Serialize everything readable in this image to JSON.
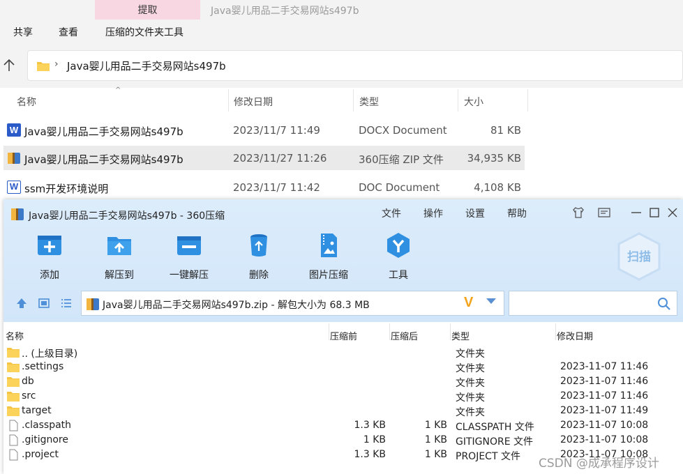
{
  "ribbon": {
    "extract_tab": "提取",
    "window_title": "Java婴儿用品二手交易网站s497b",
    "menu": [
      "共享",
      "查看",
      "压缩的文件夹工具"
    ]
  },
  "address_bar": {
    "path": "Java婴儿用品二手交易网站s497b"
  },
  "explorer": {
    "columns": [
      "名称",
      "修改日期",
      "类型",
      "大小"
    ],
    "rows": [
      {
        "name": "Java婴儿用品二手交易网站s497b",
        "date": "2023/11/7 11:49",
        "type": "DOCX Document",
        "size": "81 KB"
      },
      {
        "name": "Java婴儿用品二手交易网站s497b",
        "date": "2023/11/27 11:26",
        "type": "360压缩 ZIP 文件",
        "size": "34,935 KB"
      },
      {
        "name": "ssm开发环境说明",
        "date": "2023/11/7 11:42",
        "type": "DOC Document",
        "size": "4,108 KB"
      }
    ]
  },
  "zip_window": {
    "title": "Java婴儿用品二手交易网站s497b - 360压缩",
    "menu": [
      "文件",
      "操作",
      "设置",
      "帮助"
    ],
    "toolbar": [
      "添加",
      "解压到",
      "一键解压",
      "删除",
      "图片压缩",
      "工具"
    ],
    "scan_label": "扫描",
    "path_text": "Java婴儿用品二手交易网站s497b.zip - 解包大小为 68.3 MB",
    "search_placeholder": "",
    "columns": [
      "名称",
      "压缩前",
      "压缩后",
      "类型",
      "修改日期"
    ],
    "rows": [
      {
        "name": ".. (上级目录)",
        "before": "",
        "after": "",
        "type": "文件夹",
        "date": "",
        "icon": "folder-icon"
      },
      {
        "name": ".settings",
        "before": "",
        "after": "",
        "type": "文件夹",
        "date": "2023-11-07 11:46",
        "icon": "folder-icon"
      },
      {
        "name": "db",
        "before": "",
        "after": "",
        "type": "文件夹",
        "date": "2023-11-07 11:46",
        "icon": "folder-icon"
      },
      {
        "name": "src",
        "before": "",
        "after": "",
        "type": "文件夹",
        "date": "2023-11-07 11:46",
        "icon": "folder-icon"
      },
      {
        "name": "target",
        "before": "",
        "after": "",
        "type": "文件夹",
        "date": "2023-11-07 11:49",
        "icon": "folder-icon"
      },
      {
        "name": ".classpath",
        "before": "1.3 KB",
        "after": "1 KB",
        "type": "CLASSPATH 文件",
        "date": "2023-11-07 10:08",
        "icon": "file-icon"
      },
      {
        "name": ".gitignore",
        "before": "1 KB",
        "after": "1 KB",
        "type": "GITIGNORE 文件",
        "date": "2023-11-07 10:08",
        "icon": "file-icon"
      },
      {
        "name": ".project",
        "before": "1.3 KB",
        "after": "1 KB",
        "type": "PROJECT 文件",
        "date": "2023-11-07 10:08",
        "icon": "file-icon"
      }
    ]
  },
  "watermark": "CSDN @成承程序设计"
}
